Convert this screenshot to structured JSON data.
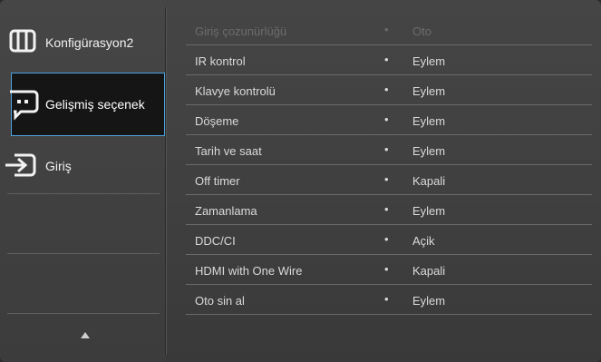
{
  "sidebar": {
    "items": [
      {
        "label": "Konfigürasyon2",
        "icon": "table-icon"
      },
      {
        "label": "Gelişmiş seçenek",
        "icon": "chat-dots-icon"
      },
      {
        "label": "Giriş",
        "icon": "input-arrow-icon"
      }
    ],
    "scroll_up": "up-arrow-icon"
  },
  "settings": {
    "rows": [
      {
        "name": "Giriş çozunürlüğü",
        "bullet": "•",
        "value": "Oto"
      },
      {
        "name": "IR kontrol",
        "bullet": "•",
        "value": "Eylem"
      },
      {
        "name": "Klavye kontrolü",
        "bullet": "•",
        "value": "Eylem"
      },
      {
        "name": "Döşeme",
        "bullet": "•",
        "value": "Eylem"
      },
      {
        "name": "Tarih ve saat",
        "bullet": "•",
        "value": "Eylem"
      },
      {
        "name": "Off timer",
        "bullet": "•",
        "value": "Kapali"
      },
      {
        "name": "Zamanlama",
        "bullet": "•",
        "value": "Eylem"
      },
      {
        "name": "DDC/CI",
        "bullet": "•",
        "value": "Açik"
      },
      {
        "name": "HDMI with One Wire",
        "bullet": "•",
        "value": "Kapali"
      },
      {
        "name": "Oto sin al",
        "bullet": "•",
        "value": "Eylem"
      }
    ]
  },
  "colors": {
    "selection_border": "#4aa3df",
    "text": "#dadada",
    "disabled_text": "#6c6c6c"
  }
}
